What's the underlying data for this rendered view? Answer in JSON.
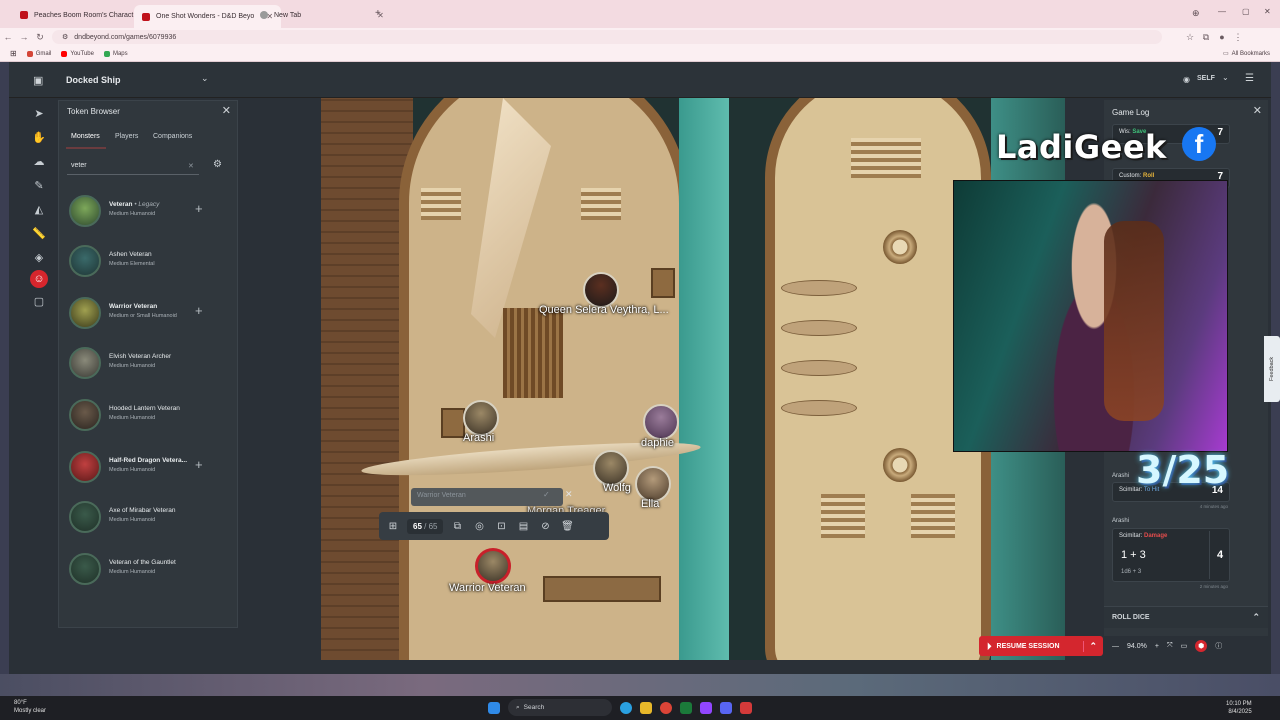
{
  "browser": {
    "tabs": [
      {
        "title": "Peaches Boom Room's Charact",
        "color": "#c0121b"
      },
      {
        "title": "One Shot Wonders - D&D Beyo",
        "color": "#c0121b"
      },
      {
        "title": "New Tab",
        "color": "#7a7a7a"
      }
    ],
    "url": "dndbeyond.com/games/6079936",
    "bookmarks": [
      "Gmail",
      "YouTube",
      "Maps"
    ],
    "all_bookmarks": "All Bookmarks"
  },
  "header": {
    "scene_name": "Docked Ship",
    "self_label": "SELF"
  },
  "token_browser": {
    "title": "Token Browser",
    "tabs": [
      "Monsters",
      "Players",
      "Companions"
    ],
    "search_value": "veter",
    "monsters": [
      {
        "name": "Veteran",
        "tag": "• Legacy",
        "type": "Medium Humanoid",
        "addable": true
      },
      {
        "name": "Ashen Veteran",
        "tag": "",
        "type": "Medium Elemental",
        "addable": false
      },
      {
        "name": "Warrior Veteran",
        "tag": "",
        "type": "Medium or Small Humanoid",
        "addable": true
      },
      {
        "name": "Elvish Veteran Archer",
        "tag": "",
        "type": "Medium Humanoid",
        "addable": false
      },
      {
        "name": "Hooded Lantern Veteran",
        "tag": "",
        "type": "Medium Humanoid",
        "addable": false
      },
      {
        "name": "Half-Red Dragon Vetera...",
        "tag": "",
        "type": "Medium Humanoid",
        "addable": true
      },
      {
        "name": "Axe of Mirabar Veteran",
        "tag": "",
        "type": "Medium Humanoid",
        "addable": false
      },
      {
        "name": "Veteran of the Gauntlet",
        "tag": "",
        "type": "Medium Humanoid",
        "addable": false
      }
    ]
  },
  "map": {
    "tokens": [
      {
        "label": "Queen Selera Veythra, L..."
      },
      {
        "label": "Arashi"
      },
      {
        "label": "daphie"
      },
      {
        "label": "Wolfg"
      },
      {
        "label": "Ella"
      },
      {
        "label": "Morgan Treager"
      },
      {
        "label": "Warrior Veteran"
      }
    ],
    "token_popup": {
      "name_placeholder": "Warrior Veteran",
      "hp_current": "65",
      "hp_max": "/ 65"
    }
  },
  "game_log": {
    "title": "Game Log",
    "entries": [
      {
        "head_label": "Wis:",
        "head_kind": "Save",
        "total": "7"
      },
      {
        "head_label": "Custom:",
        "head_kind": "Roll",
        "total": "7"
      },
      {
        "roller": "Arashi",
        "head_label": "Scimitar:",
        "head_kind": "To Hit",
        "total": "14",
        "time": "4 minutes ago"
      },
      {
        "roller": "Arashi",
        "head_label": "Scimitar:",
        "head_kind": "Damage",
        "expr": "1 + 3",
        "formula": "1d6 + 3",
        "total": "4",
        "time": "2 minutes ago"
      }
    ],
    "roll_dice": "ROLL DICE"
  },
  "controls": {
    "resume_session": "RESUME SESSION",
    "zoom": "94.0%"
  },
  "overlay": {
    "brand": "LadiGeek",
    "social_icon": "facebook-icon",
    "counter": "3/25",
    "feedback": "Feedback"
  },
  "taskbar": {
    "temp": "80°F",
    "weather": "Mostly clear",
    "search_placeholder": "Search",
    "time": "10:10 PM",
    "date": "8/4/2025"
  }
}
